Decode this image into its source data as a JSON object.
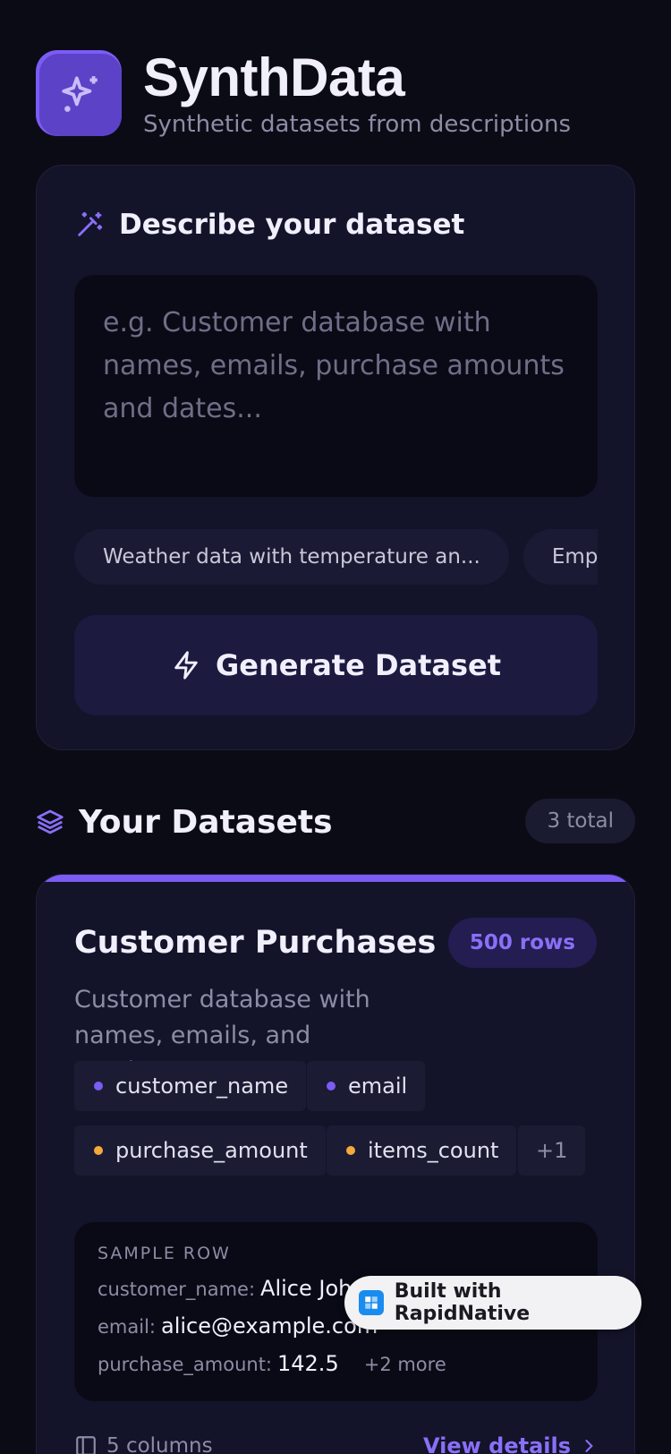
{
  "app": {
    "title": "SynthData",
    "subtitle": "Synthetic datasets from descriptions",
    "logo_icon": "sparkles-icon"
  },
  "describe": {
    "heading": "Describe your dataset",
    "heading_icon": "magic-wand-icon",
    "placeholder": "e.g. Customer database with names, emails, purchase amounts and dates...",
    "value": "",
    "suggestions": [
      "Weather data with temperature an...",
      "Emplo"
    ],
    "generate_label": "Generate Dataset",
    "generate_icon": "lightning-icon"
  },
  "datasets": {
    "heading": "Your Datasets",
    "heading_icon": "layers-icon",
    "total_label": "3 total",
    "items": [
      {
        "name": "Customer Purchases",
        "rows_label": "500 rows",
        "description": "Customer database with names, emails, and purchase...",
        "columns": [
          {
            "name": "customer_name",
            "color": "#7c5cf5"
          },
          {
            "name": "email",
            "color": "#7c5cf5"
          },
          {
            "name": "purchase_amount",
            "color": "#f4a93a"
          },
          {
            "name": "items_count",
            "color": "#f4a93a"
          }
        ],
        "more_columns": "+1",
        "sample_label": "SAMPLE ROW",
        "sample": [
          {
            "key": "customer_name:",
            "value": "Alice Joh"
          },
          {
            "key": "email:",
            "value": "alice@example.com"
          },
          {
            "key": "purchase_amount:",
            "value": "142.5",
            "extra": "+2 more"
          }
        ],
        "columns_count_label": "5 columns",
        "view_label": "View details"
      }
    ]
  },
  "overlay": {
    "built_with": "Built with RapidNative"
  },
  "colors": {
    "accent": "#7c5cf5",
    "background": "#0b0b16",
    "card": "#13132a"
  }
}
